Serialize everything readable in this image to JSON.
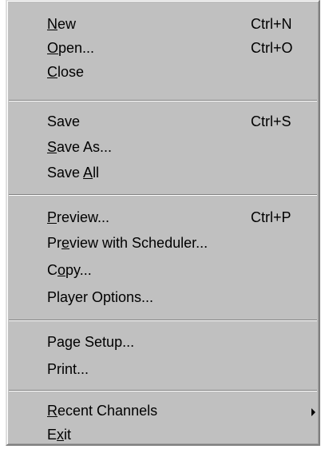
{
  "menu": {
    "items": [
      {
        "label": "New",
        "mnemonic": "N",
        "shortcut": "Ctrl+N"
      },
      {
        "label": "Open...",
        "mnemonic": "O",
        "shortcut": "Ctrl+O"
      },
      {
        "label": "Close",
        "mnemonic": "C",
        "shortcut": ""
      },
      {
        "label": "Save",
        "mnemonic": "",
        "shortcut": "Ctrl+S"
      },
      {
        "label": "Save As...",
        "mnemonic": "S",
        "shortcut": ""
      },
      {
        "label": "Save All",
        "mnemonic": "A",
        "shortcut": ""
      },
      {
        "label": "Preview...",
        "mnemonic": "P",
        "shortcut": "Ctrl+P"
      },
      {
        "label": "Preview with Scheduler...",
        "mnemonic": "e",
        "shortcut": ""
      },
      {
        "label": "Copy...",
        "mnemonic": "o",
        "shortcut": ""
      },
      {
        "label": "Player Options...",
        "mnemonic": "",
        "shortcut": ""
      },
      {
        "label": "Page Setup...",
        "mnemonic": "",
        "shortcut": ""
      },
      {
        "label": "Print...",
        "mnemonic": "",
        "shortcut": ""
      },
      {
        "label": "Recent Channels",
        "mnemonic": "R",
        "shortcut": "",
        "submenu_icon": "submenu-arrow-icon"
      },
      {
        "label": "Exit",
        "mnemonic": "x",
        "shortcut": ""
      }
    ]
  },
  "colors": {
    "menu_background": "#c0c0c0",
    "text": "#000000",
    "separator_dark": "#808080",
    "separator_light": "#ffffff"
  }
}
